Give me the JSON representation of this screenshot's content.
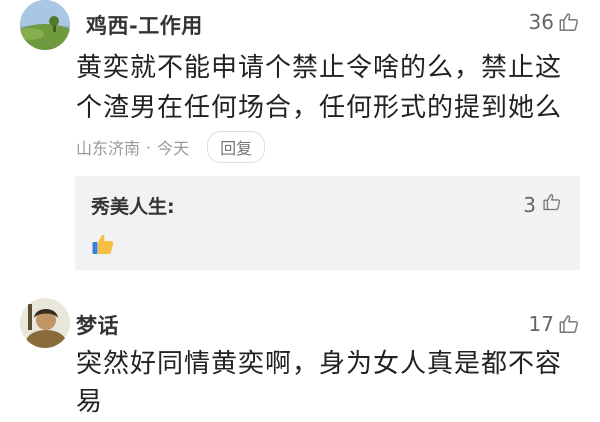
{
  "comments": [
    {
      "username": "鸡西-工作用",
      "likes": "36",
      "text_lines": [
        "黄奕就不能申请个禁止令啥的么，禁止这",
        "个渣男在任何场合，任何形式的提到她么"
      ],
      "location": "山东济南",
      "separator": "·",
      "time": "今天",
      "reply_label": "回复",
      "avatar_icon": "landscape-avatar-icon"
    },
    {
      "username": "梦话",
      "likes": "17",
      "text_lines": [
        "突然好同情黄奕啊，身为女人真是都不容",
        "易"
      ],
      "avatar_icon": "portrait-avatar-icon"
    }
  ],
  "reply": {
    "username": "秀美人生:",
    "likes": "3",
    "content_icon": "thumbs-up-emoji-icon"
  },
  "colors": {
    "like_gray": "#666666",
    "reply_bg": "#f2f2f2",
    "meta_gray": "#999999"
  }
}
